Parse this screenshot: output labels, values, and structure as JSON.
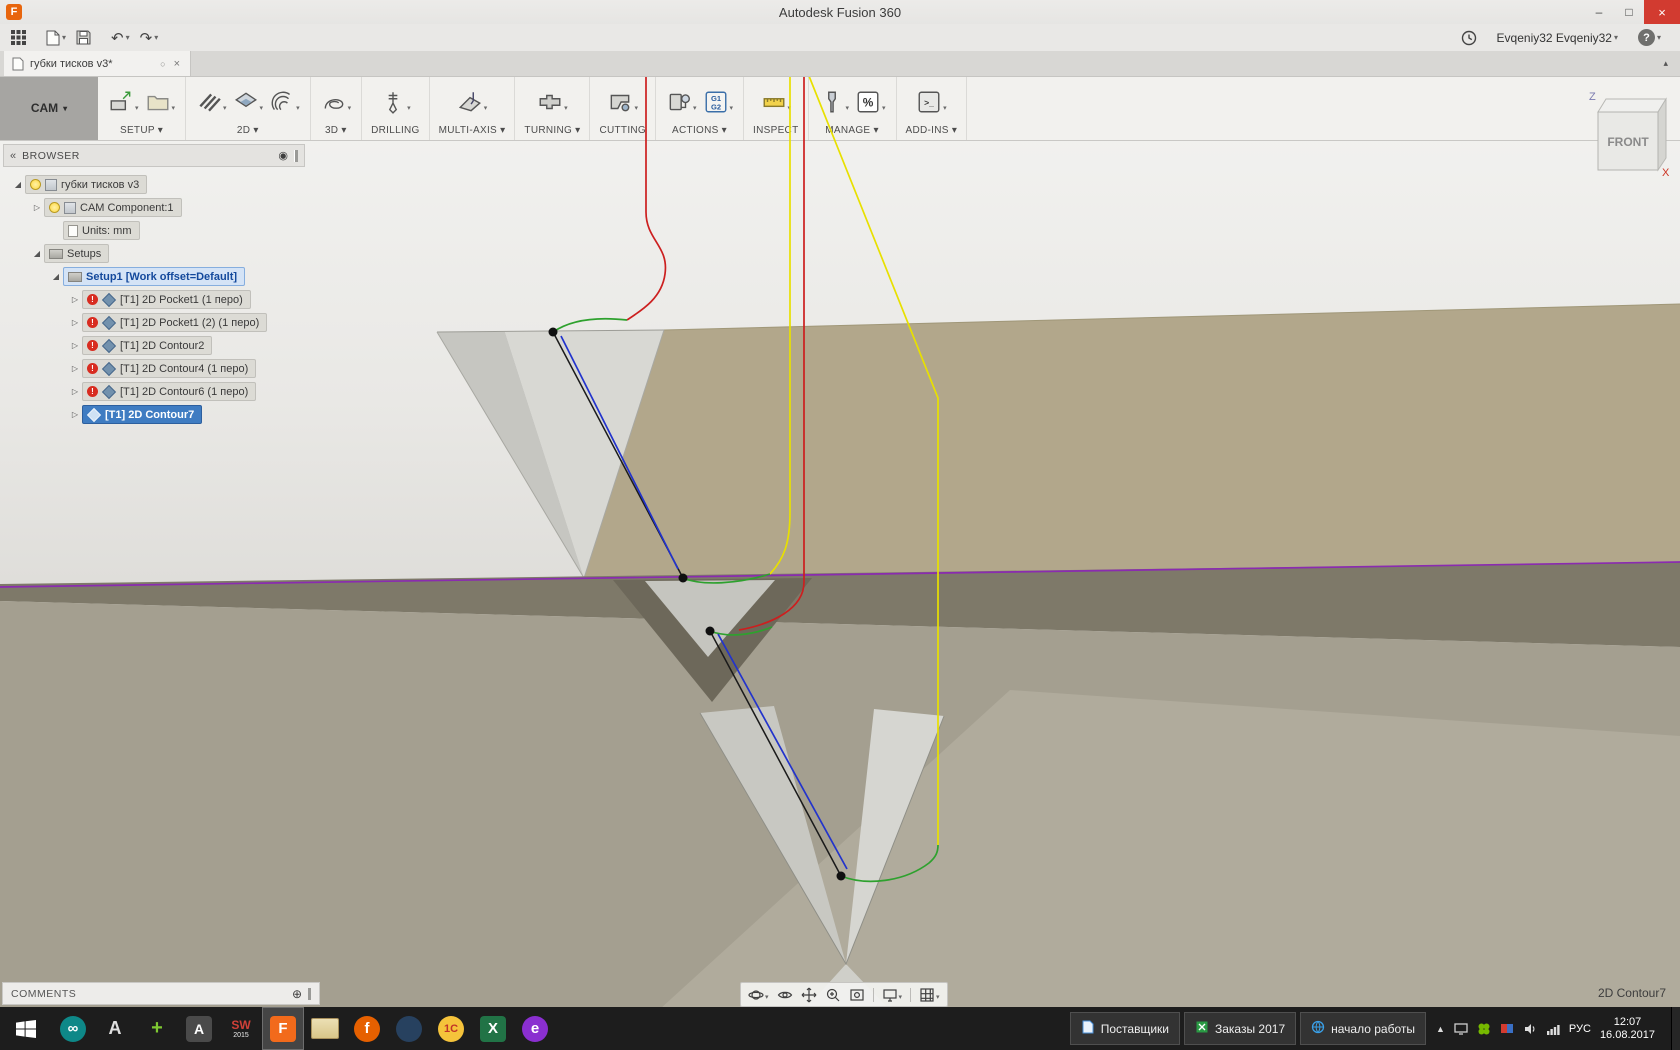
{
  "glyphs": {
    "caret": "▾",
    "close": "×",
    "circle": "○",
    "collapse": "▴",
    "chevrons": "«",
    "panel_dot": "◉",
    "expand": "⊕",
    "minimize": "–",
    "maximize": "□",
    "up": "▲",
    "warn": "!",
    "expanded": "◢",
    "collapsed": "▷",
    "logo": "F",
    "undo": "↶",
    "redo": "↷"
  },
  "titlebar": {
    "title": "Autodesk Fusion 360"
  },
  "qat": {
    "user": "Evqeniy32 Evqeniy32",
    "help": "?"
  },
  "tabs": {
    "active": "губки тисков v3*"
  },
  "ribbon": {
    "workspace_label": "CAM",
    "groups": [
      {
        "label": "SETUP",
        "caret": true,
        "icons": [
          "setup",
          "folder"
        ]
      },
      {
        "label": "2D",
        "caret": true,
        "icons": [
          "face",
          "pocket",
          "contour"
        ]
      },
      {
        "label": "3D",
        "caret": true,
        "icons": [
          "adaptive"
        ]
      },
      {
        "label": "DRILLING",
        "caret": false,
        "icons": [
          "drill"
        ]
      },
      {
        "label": "MULTI-AXIS",
        "caret": true,
        "icons": [
          "multiaxis"
        ]
      },
      {
        "label": "TURNING",
        "caret": true,
        "icons": [
          "turning"
        ]
      },
      {
        "label": "CUTTING",
        "caret": false,
        "icons": [
          "cutting"
        ]
      },
      {
        "label": "ACTIONS",
        "caret": true,
        "icons": [
          "postprocess",
          "gcode"
        ]
      },
      {
        "label": "INSPECT",
        "caret": false,
        "icons": [
          "measure"
        ]
      },
      {
        "label": "MANAGE",
        "caret": true,
        "icons": [
          "toollib",
          "percent"
        ]
      },
      {
        "label": "ADD-INS",
        "caret": true,
        "icons": [
          "addins"
        ]
      }
    ],
    "icon_texts": {
      "gcode_top": "G1",
      "gcode_bottom": "G2",
      "percent": "%",
      "addins": ">_"
    }
  },
  "browser": {
    "header": "BROWSER",
    "tree": [
      {
        "indent": 0,
        "expander": "expanded",
        "icons": [
          "bulb",
          "component"
        ],
        "label": "губки тисков v3",
        "style": ""
      },
      {
        "indent": 1,
        "expander": "collapsed",
        "icons": [
          "bulb",
          "component"
        ],
        "label": "CAM Component:1",
        "style": ""
      },
      {
        "indent": 2,
        "expander": "none",
        "icons": [
          "doc"
        ],
        "label": "Units: mm",
        "style": ""
      },
      {
        "indent": 1,
        "expander": "expanded",
        "icons": [
          "setups"
        ],
        "label": "Setups",
        "style": ""
      },
      {
        "indent": 2,
        "expander": "expanded",
        "icons": [
          "setups"
        ],
        "label": "Setup1 [Work offset=Default]",
        "style": "setup-selected"
      },
      {
        "indent": 3,
        "expander": "collapsed",
        "icons": [
          "warn",
          "op"
        ],
        "label": "[T1] 2D Pocket1 (1 перо)",
        "style": ""
      },
      {
        "indent": 3,
        "expander": "collapsed",
        "icons": [
          "warn",
          "op"
        ],
        "label": "[T1] 2D Pocket1 (2) (1 перо)",
        "style": ""
      },
      {
        "indent": 3,
        "expander": "collapsed",
        "icons": [
          "warn",
          "op"
        ],
        "label": "[T1] 2D Contour2",
        "style": ""
      },
      {
        "indent": 3,
        "expander": "collapsed",
        "icons": [
          "warn",
          "op"
        ],
        "label": "[T1] 2D Contour4 (1 перо)",
        "style": ""
      },
      {
        "indent": 3,
        "expander": "collapsed",
        "icons": [
          "warn",
          "op"
        ],
        "label": "[T1] 2D Contour6 (1 перо)",
        "style": ""
      },
      {
        "indent": 3,
        "expander": "collapsed",
        "icons": [
          "op-sel"
        ],
        "label": "[T1] 2D Contour7",
        "style": "selected"
      }
    ]
  },
  "viewcube": {
    "front": "FRONT",
    "axis_z": "Z",
    "axis_x": "X"
  },
  "viewport": {
    "selected_operation": "2D Contour7",
    "toolpath_colors": {
      "retract": "#cc1f1f",
      "rapid": "#e8e000",
      "lead": "#2ea12e",
      "cut_black": "#1a1a1a",
      "cut_blue": "#2233cc",
      "stock_line": "#8a2bb0"
    }
  },
  "comments": {
    "label": "COMMENTS"
  },
  "taskbar": {
    "apps": [
      {
        "name": "arduino",
        "glyph": "∞",
        "shape": "circle",
        "bg": "#0e8888",
        "fg": "#ffffff",
        "size": "15"
      },
      {
        "name": "cad-a",
        "glyph": "A",
        "shape": "plain",
        "bg": "",
        "fg": "#e0e0e0",
        "size": "18"
      },
      {
        "name": "green-tool",
        "glyph": "+",
        "shape": "plain",
        "bg": "",
        "fg": "#7ec832",
        "size": "20"
      },
      {
        "name": "editor-a",
        "glyph": "A",
        "shape": "square",
        "bg": "#4a4a4a",
        "fg": "#ffffff",
        "size": "14"
      },
      {
        "name": "solidworks",
        "glyph": "SW",
        "sub": "2015",
        "shape": "plain",
        "bg": "",
        "fg": "#d04038",
        "size": "12"
      },
      {
        "name": "fusion-360",
        "glyph": "F",
        "shape": "square",
        "bg": "#f26a1b",
        "fg": "#ffffff",
        "size": "15",
        "active": true
      },
      {
        "name": "file-manager",
        "glyph": "",
        "shape": "folder",
        "bg": "#e0d3a8",
        "fg": "#8a6d3b",
        "size": "14"
      },
      {
        "name": "firefox",
        "glyph": "f",
        "shape": "circle",
        "bg": "#e66000",
        "fg": "#ffffff",
        "size": "15"
      },
      {
        "name": "dark-browser",
        "glyph": "",
        "shape": "circle",
        "bg": "#27415f",
        "fg": "#ffffff",
        "size": "14"
      },
      {
        "name": "1c-enterprise",
        "glyph": "1С",
        "shape": "circle",
        "bg": "#f5c33b",
        "fg": "#c23327",
        "size": "11"
      },
      {
        "name": "excel",
        "glyph": "X",
        "shape": "square",
        "bg": "#217346",
        "fg": "#ffffff",
        "size": "15"
      },
      {
        "name": "purple-e",
        "glyph": "e",
        "shape": "circle",
        "bg": "#8a2fd0",
        "fg": "#ffffff",
        "size": "15"
      }
    ],
    "windows": [
      {
        "icon": "doc",
        "label": "Поставщики"
      },
      {
        "icon": "sheet",
        "label": "Заказы 2017"
      },
      {
        "icon": "globe",
        "label": "начало работы"
      }
    ],
    "language": "РУС",
    "time": "12:07",
    "date": "16.08.2017"
  }
}
